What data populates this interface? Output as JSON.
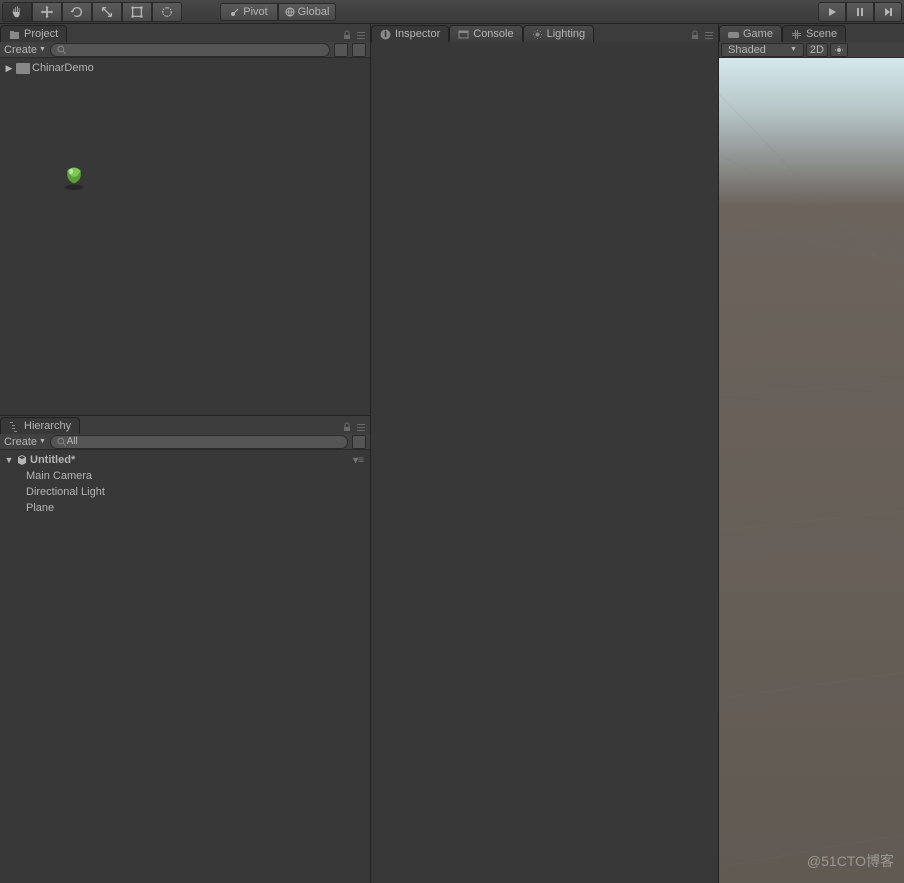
{
  "toolbar": {
    "pivot_label": "Pivot",
    "global_label": "Global"
  },
  "project": {
    "tab_label": "Project",
    "create_label": "Create",
    "search_placeholder": "",
    "folder_name": "ChinarDemo"
  },
  "hierarchy": {
    "tab_label": "Hierarchy",
    "create_label": "Create",
    "search_value": "All",
    "scene_name": "Untitled*",
    "items": [
      {
        "label": "Main Camera"
      },
      {
        "label": "Directional Light"
      },
      {
        "label": "Plane"
      }
    ]
  },
  "inspector": {
    "tabs": [
      {
        "label": "Inspector",
        "icon": "info"
      },
      {
        "label": "Console",
        "icon": "console"
      },
      {
        "label": "Lighting",
        "icon": "light"
      }
    ]
  },
  "right": {
    "tabs": [
      {
        "label": "Game",
        "icon": "game"
      },
      {
        "label": "Scene",
        "icon": "scene"
      }
    ],
    "shaded_label": "Shaded",
    "twod_label": "2D"
  },
  "watermark": "@51CTO博客"
}
